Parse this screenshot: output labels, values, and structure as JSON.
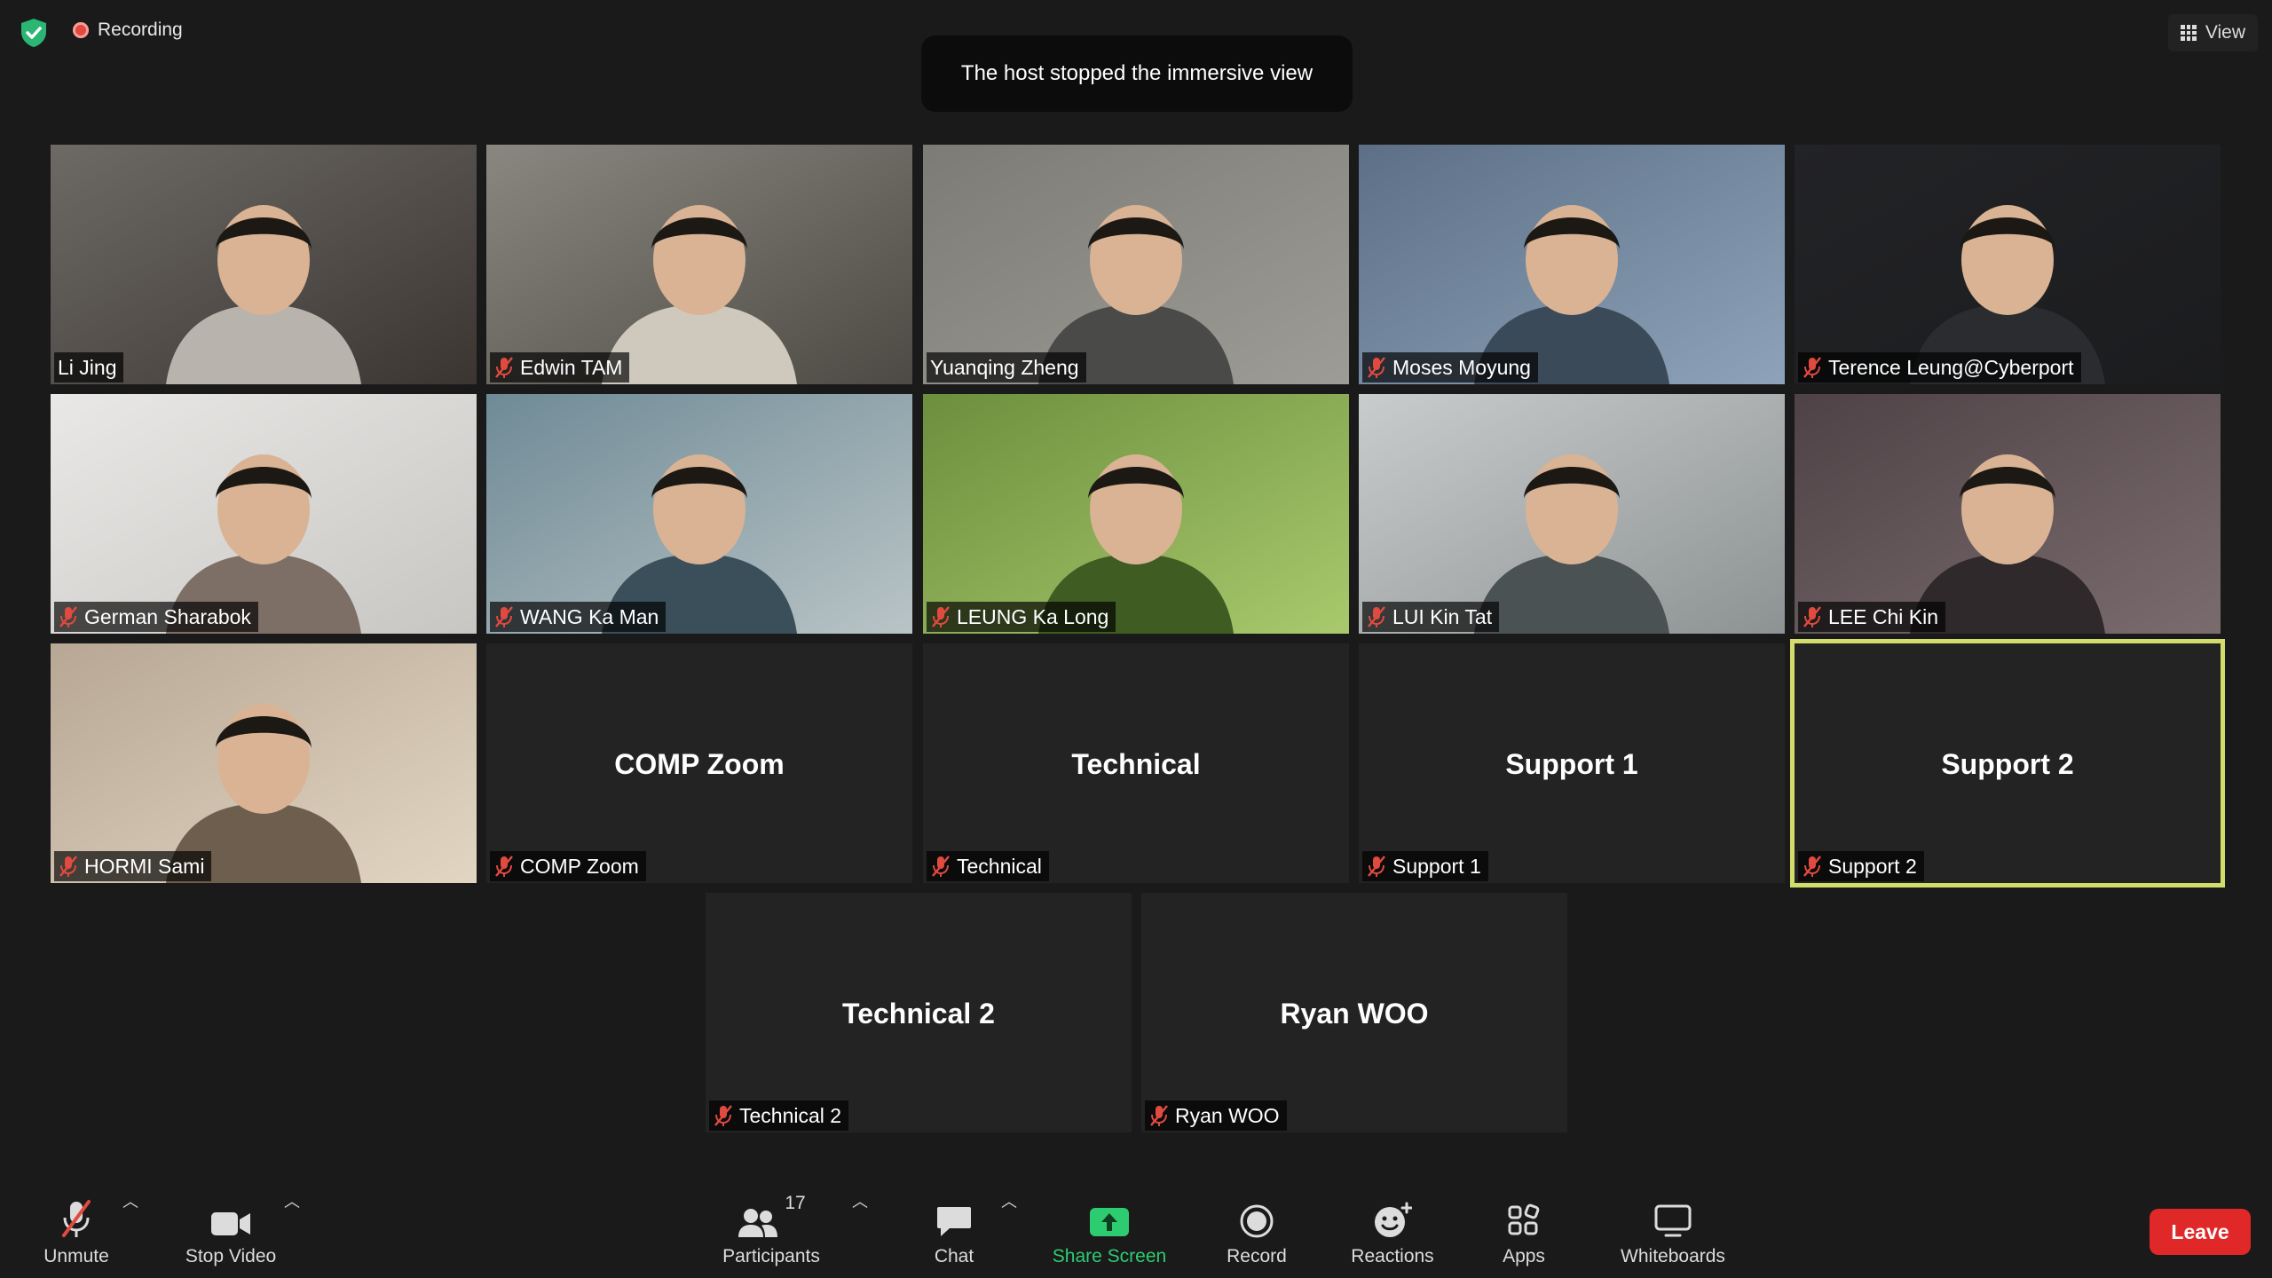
{
  "top": {
    "recording_label": "Recording",
    "toast": "The host stopped the immersive view",
    "view_label": "View"
  },
  "tiles": [
    {
      "name": "Li Jing",
      "muted": false,
      "video": true
    },
    {
      "name": "Edwin TAM",
      "muted": true,
      "video": true
    },
    {
      "name": "Yuanqing Zheng",
      "muted": false,
      "video": true
    },
    {
      "name": "Moses Moyung",
      "muted": true,
      "video": true
    },
    {
      "name": "Terence Leung@Cyberport",
      "muted": true,
      "video": true
    },
    {
      "name": "German Sharabok",
      "muted": true,
      "video": true
    },
    {
      "name": "WANG Ka Man",
      "muted": true,
      "video": true
    },
    {
      "name": "LEUNG Ka Long",
      "muted": true,
      "video": true
    },
    {
      "name": "LUI Kin Tat",
      "muted": true,
      "video": true
    },
    {
      "name": "LEE Chi Kin",
      "muted": true,
      "video": true
    },
    {
      "name": "HORMI Sami",
      "muted": true,
      "video": true
    },
    {
      "name": "COMP Zoom",
      "muted": true,
      "video": false,
      "big": "COMP Zoom"
    },
    {
      "name": "Technical",
      "muted": true,
      "video": false,
      "big": "Technical"
    },
    {
      "name": "Support 1",
      "muted": true,
      "video": false,
      "big": "Support 1"
    },
    {
      "name": "Support 2",
      "muted": true,
      "video": false,
      "big": "Support 2",
      "active": true
    },
    {
      "name": "Technical 2",
      "muted": true,
      "video": false,
      "big": "Technical 2"
    },
    {
      "name": "Ryan WOO",
      "muted": true,
      "video": false,
      "big": "Ryan WOO"
    }
  ],
  "toolbar": {
    "unmute": "Unmute",
    "stop_video": "Stop Video",
    "participants": "Participants",
    "participants_count": "17",
    "chat": "Chat",
    "share_screen": "Share Screen",
    "record": "Record",
    "reactions": "Reactions",
    "apps": "Apps",
    "whiteboards": "Whiteboards",
    "leave": "Leave"
  },
  "colors": {
    "background": "#1a1a1a",
    "tile": "#232323",
    "active_speaker": "#d3dd6b",
    "share_green": "#2ecc71",
    "leave_red": "#e02828",
    "mute_red": "#e04a3f"
  }
}
